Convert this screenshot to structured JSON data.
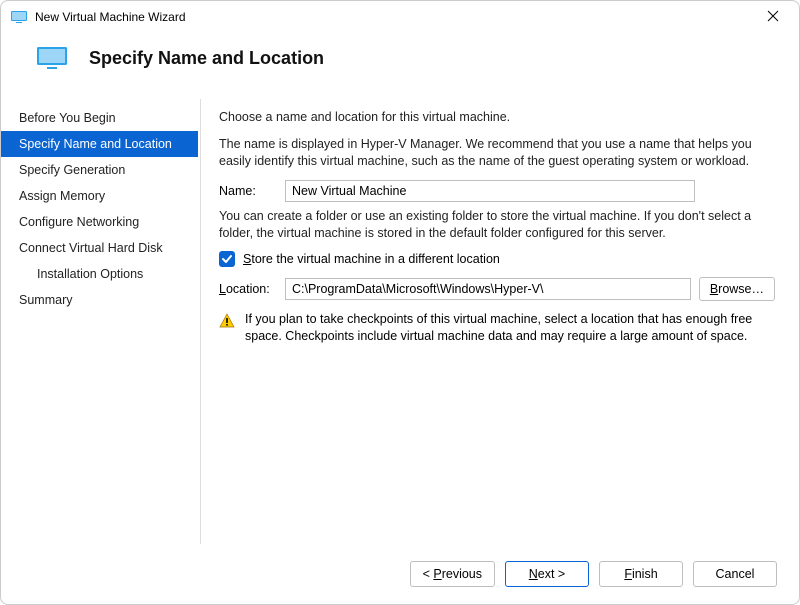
{
  "window": {
    "title": "New Virtual Machine Wizard"
  },
  "header": {
    "title": "Specify Name and Location"
  },
  "sidebar": {
    "items": [
      {
        "label": "Before You Begin",
        "selected": false,
        "indent": 0
      },
      {
        "label": "Specify Name and Location",
        "selected": true,
        "indent": 0
      },
      {
        "label": "Specify Generation",
        "selected": false,
        "indent": 0
      },
      {
        "label": "Assign Memory",
        "selected": false,
        "indent": 0
      },
      {
        "label": "Configure Networking",
        "selected": false,
        "indent": 0
      },
      {
        "label": "Connect Virtual Hard Disk",
        "selected": false,
        "indent": 0
      },
      {
        "label": "Installation Options",
        "selected": false,
        "indent": 1
      },
      {
        "label": "Summary",
        "selected": false,
        "indent": 0
      }
    ]
  },
  "content": {
    "intro": "Choose a name and location for this virtual machine.",
    "name_explain": "The name is displayed in Hyper-V Manager. We recommend that you use a name that helps you easily identify this virtual machine, such as the name of the guest operating system or workload.",
    "name_label": "Name:",
    "name_value": "New Virtual Machine",
    "folder_explain": "You can create a folder or use an existing folder to store the virtual machine. If you don't select a folder, the virtual machine is stored in the default folder configured for this server.",
    "store_checkbox_checked": true,
    "store_checkbox_label_pre": "S",
    "store_checkbox_label_post": "tore the virtual machine in a different location",
    "location_label_pre": "L",
    "location_label_post": "ocation:",
    "location_value": "C:\\ProgramData\\Microsoft\\Windows\\Hyper-V\\",
    "browse_label_pre": "B",
    "browse_label_post": "rowse…",
    "warning_text": "If you plan to take checkpoints of this virtual machine, select a location that has enough free space. Checkpoints include virtual machine data and may require a large amount of space."
  },
  "footer": {
    "previous_pre": "< ",
    "previous_key": "P",
    "previous_post": "revious",
    "next_key": "N",
    "next_post": "ext >",
    "finish_key": "F",
    "finish_post": "inish",
    "cancel": "Cancel"
  }
}
